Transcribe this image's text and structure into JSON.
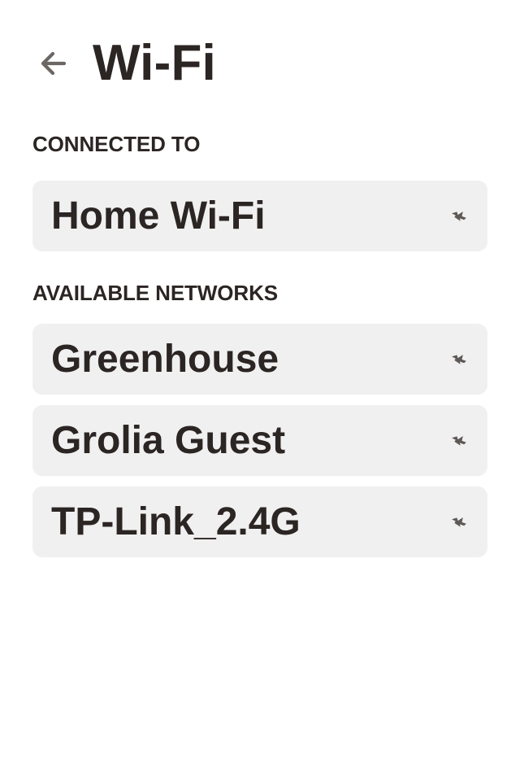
{
  "header": {
    "title": "Wi-Fi"
  },
  "sections": {
    "connected": {
      "label": "CONNECTED TO",
      "network": {
        "name": "Home Wi-Fi",
        "icon": "signal-icon"
      }
    },
    "available": {
      "label": "AVAILABLE NETWORKS",
      "networks": [
        {
          "name": "Greenhouse",
          "icon": "signal-icon"
        },
        {
          "name": "Grolia Guest",
          "icon": "signal-icon"
        },
        {
          "name": "TP-Link_2.4G",
          "icon": "signal-icon"
        }
      ]
    }
  },
  "colors": {
    "background": "#ffffff",
    "text": "#2b2523",
    "card": "#f1f0f0",
    "icon": "#5d5957",
    "back_icon": "#6c6764"
  }
}
